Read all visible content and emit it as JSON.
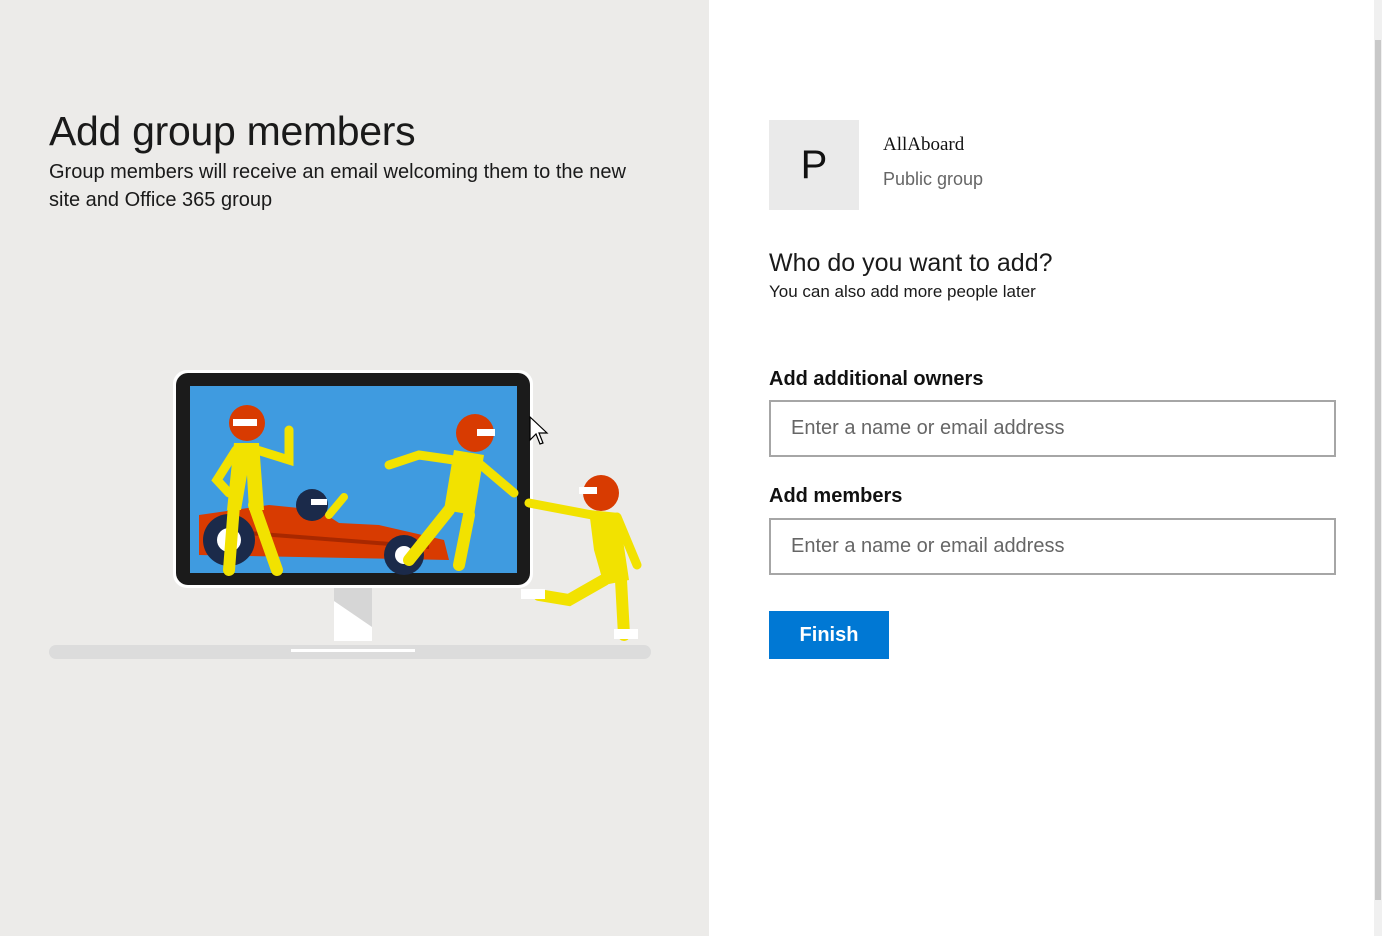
{
  "left_panel": {
    "title": "Add group members",
    "subtitle": "Group members will receive an email welcoming them to the new site and Office 365 group"
  },
  "group": {
    "avatar_letter": "P",
    "name": "AllAboard",
    "type": "Public group"
  },
  "form": {
    "question": "Who do you want to add?",
    "question_sub": "You can also add more people later",
    "owners_label": "Add additional owners",
    "owners_placeholder": "Enter a name or email address",
    "members_label": "Add members",
    "members_placeholder": "Enter a name or email address",
    "finish_label": "Finish"
  },
  "colors": {
    "left_bg": "#ecebe9",
    "accent": "#0078d4",
    "screen_blue": "#3f9be0",
    "suit_yellow": "#f2e200",
    "helmet_red": "#d83b01"
  }
}
